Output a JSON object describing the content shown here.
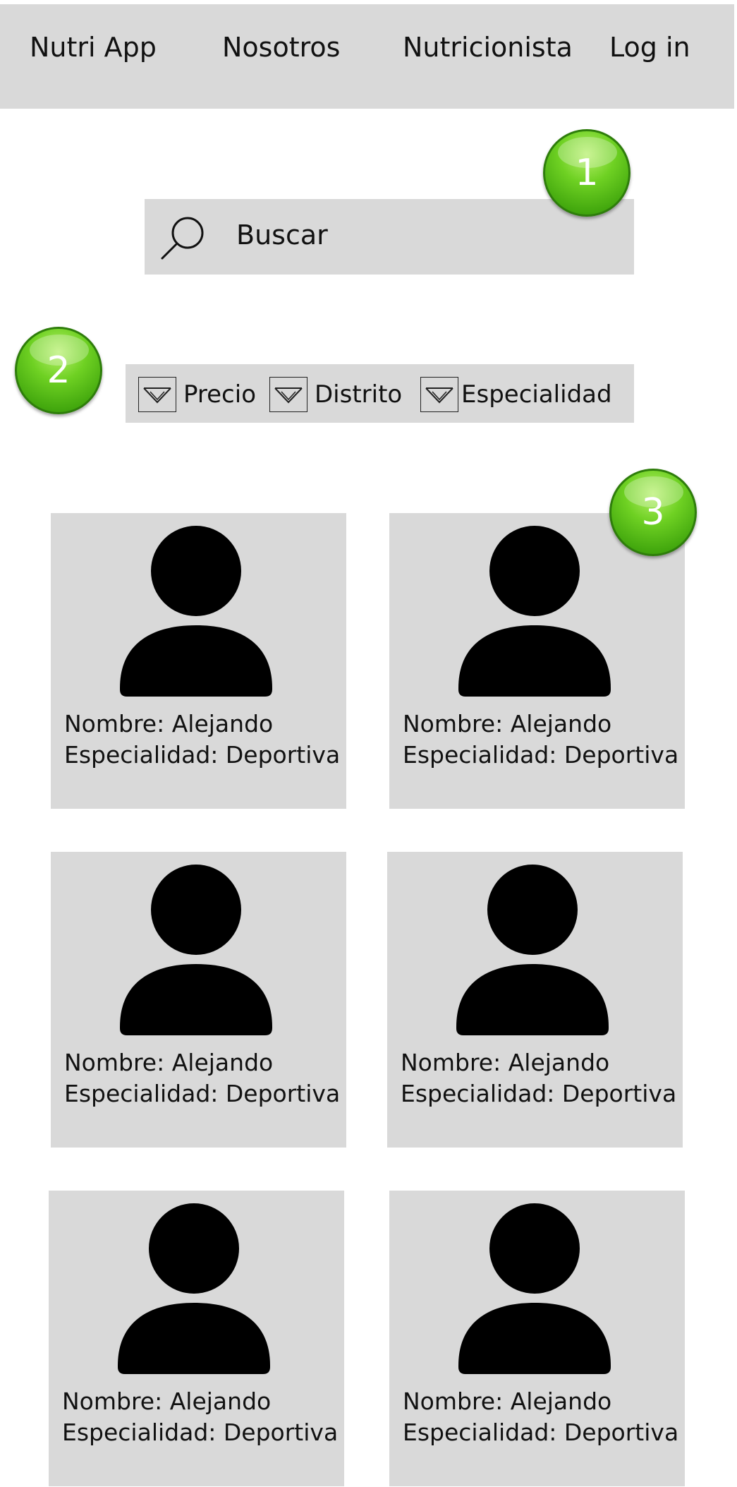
{
  "nav": {
    "brand": "Nutri App",
    "items": [
      "Nosotros",
      "Nutricionista",
      "Log in"
    ]
  },
  "search": {
    "label": "Buscar",
    "icon": "search-icon"
  },
  "filters": [
    {
      "label": "Precio",
      "icon": "chevron-down-icon"
    },
    {
      "label": "Distrito",
      "icon": "chevron-down-icon"
    },
    {
      "label": "Especialidad",
      "icon": "chevron-down-icon"
    }
  ],
  "cards": [
    {
      "name": "Nombre: Alejando",
      "specialty": "Especialidad: Deportiva"
    },
    {
      "name": "Nombre: Alejando",
      "specialty": "Especialidad: Deportiva"
    },
    {
      "name": "Nombre: Alejando",
      "specialty": "Especialidad: Deportiva"
    },
    {
      "name": "Nombre: Alejando",
      "specialty": "Especialidad: Deportiva"
    },
    {
      "name": "Nombre: Alejando",
      "specialty": "Especialidad: Deportiva"
    },
    {
      "name": "Nombre: Alejando",
      "specialty": "Especialidad: Deportiva"
    }
  ],
  "badges": [
    "1",
    "2",
    "3"
  ],
  "colors": {
    "panel": "#d9d9d9",
    "badge": "#5cc41a",
    "avatar": "#000000"
  }
}
